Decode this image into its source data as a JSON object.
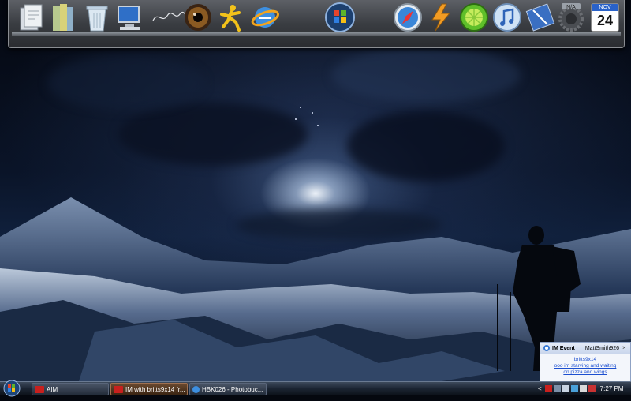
{
  "dock": {
    "items": [
      {
        "name": "documents-icon"
      },
      {
        "name": "books-icon"
      },
      {
        "name": "recycle-bin-icon"
      },
      {
        "name": "computer-icon"
      },
      {
        "name": "signature-logo-icon"
      },
      {
        "name": "eye-icon"
      },
      {
        "name": "aim-running-man-icon"
      },
      {
        "name": "internet-explorer-icon"
      },
      {
        "name": "windows-orb-icon"
      },
      {
        "name": "safari-compass-icon"
      },
      {
        "name": "winamp-icon"
      },
      {
        "name": "limewire-icon"
      },
      {
        "name": "itunes-icon"
      },
      {
        "name": "media-player-icon"
      },
      {
        "name": "gear-icon"
      },
      {
        "name": "calendar-icon"
      }
    ],
    "badge_label": "N/A",
    "calendar_month": "NOV",
    "calendar_day": "24"
  },
  "im_popup": {
    "title": "IM Event",
    "account": "MattSmith926",
    "sender": "britts9x14",
    "message_line1": "ooo im starving and waiting",
    "message_line2": "on pizza and wings"
  },
  "taskbar": {
    "buttons": [
      {
        "label": "AIM",
        "icon": "aim-icon"
      },
      {
        "label": "IM with britts9x14 fr...",
        "icon": "aim-icon"
      },
      {
        "label": "HBK026 - Photobuc...",
        "icon": "internet-explorer-icon"
      }
    ],
    "clock": "7:27 PM",
    "tray_expand_label": "<"
  },
  "colors": {
    "taskbar": "#1b2432",
    "dock": "#3a3d42",
    "link": "#1c4fd0"
  }
}
